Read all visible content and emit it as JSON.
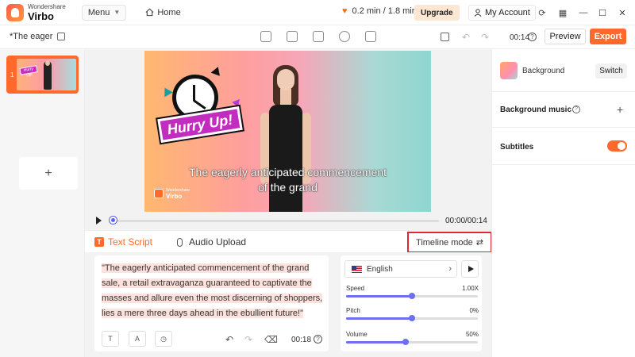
{
  "app": {
    "brand_line1": "Wondershare",
    "brand_line2": "Virbo"
  },
  "titlebar": {
    "menu_label": "Menu",
    "home_label": "Home",
    "usage": "0.2 min / 1.8 min",
    "upgrade_label": "Upgrade",
    "account_label": "My Account"
  },
  "project": {
    "title": "*The eager",
    "duration": "00:14",
    "preview_label": "Preview",
    "export_label": "Export"
  },
  "slides": {
    "items": [
      {
        "number": "1",
        "thumb_text": "Hurry Up!"
      }
    ],
    "add_label": "+"
  },
  "canvas": {
    "sticker_text": "Hurry Up!",
    "subtitle_line1": "The eagerly anticipated commencement",
    "subtitle_line2": "of the grand",
    "watermark_line1": "Wondershare",
    "watermark_line2": "Virbo",
    "time_display": "00:00/00:14",
    "progress": 0.0
  },
  "script_panel": {
    "tabs": [
      {
        "label": "Text Script",
        "icon": "T"
      },
      {
        "label": "Audio Upload"
      }
    ],
    "timeline_mode_label": "Timeline mode",
    "script_text": "\"The eagerly anticipated commencement of the grand sale, a retail extravaganza guaranteed to captivate the masses and allure even the most discerning of shoppers, lies a mere three days ahead in the ebullient future!\"",
    "script_duration": "00:18",
    "help_glyph": "?"
  },
  "voice": {
    "language": "English",
    "sliders": [
      {
        "label": "Speed",
        "value_text": "1.00X",
        "level": 0.5
      },
      {
        "label": "Pitch",
        "value_text": "0%",
        "level": 0.5
      },
      {
        "label": "Volume",
        "value_text": "50%",
        "level": 0.45
      }
    ]
  },
  "right_panel": {
    "background_label": "Background",
    "switch_label": "Switch",
    "music_label": "Background music",
    "subtitles_label": "Subtitles",
    "subtitles_on": true
  },
  "colors": {
    "accent": "#ff6a2c",
    "slider": "#6d6ef0",
    "highlight": "#e0262e"
  }
}
